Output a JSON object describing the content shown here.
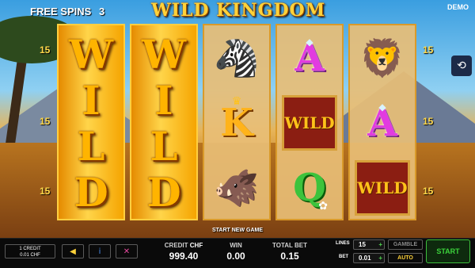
{
  "header": {
    "free_spins_label": "FREE SPINS",
    "free_spins_count": "3",
    "logo": "WILD KINGDOM",
    "mode": "DEMO"
  },
  "paylines": {
    "left": [
      "15",
      "15",
      "15"
    ],
    "right": [
      "15",
      "15",
      "15"
    ]
  },
  "reels": [
    {
      "type": "wild-stack",
      "letters": [
        "W",
        "I",
        "L",
        "D"
      ]
    },
    {
      "type": "wild-stack",
      "letters": [
        "W",
        "I",
        "L",
        "D"
      ]
    },
    {
      "type": "symbols",
      "symbols": [
        {
          "kind": "animal",
          "name": "zebra-icon",
          "glyph": "🦓"
        },
        {
          "kind": "letter",
          "name": "king-symbol",
          "text": "K"
        },
        {
          "kind": "animal",
          "name": "warthog-icon",
          "glyph": "🐗"
        }
      ]
    },
    {
      "type": "symbols",
      "symbols": [
        {
          "kind": "letter",
          "name": "ace-symbol",
          "text": "A"
        },
        {
          "kind": "wild",
          "name": "wild-symbol",
          "text": "WILD"
        },
        {
          "kind": "letter",
          "name": "queen-symbol",
          "text": "Q"
        }
      ]
    },
    {
      "type": "symbols",
      "symbols": [
        {
          "kind": "animal",
          "name": "lion-icon",
          "glyph": "🦁"
        },
        {
          "kind": "letter",
          "name": "ace-symbol",
          "text": "A"
        },
        {
          "kind": "wild",
          "name": "wild-symbol",
          "text": "WILD"
        }
      ]
    }
  ],
  "prompt": "START NEW GAME",
  "footer": {
    "credit_box": {
      "line1": "1 CREDIT",
      "line2": "0.01 CHF"
    },
    "sound_icon": "◀",
    "info_icon": "i",
    "fullscreen_icon": "✕",
    "credit": {
      "label": "CREDIT",
      "currency": "CHF",
      "value": "999.40"
    },
    "win": {
      "label": "WIN",
      "value": "0.00"
    },
    "total_bet": {
      "label": "TOTAL BET",
      "value": "0.15"
    },
    "lines": {
      "label": "LINES",
      "value": "15",
      "plus": "+"
    },
    "bet": {
      "label": "BET",
      "value": "0.01",
      "plus": "+"
    },
    "gamble": "GAMBLE",
    "auto": "AUTO",
    "start": "START"
  },
  "history_icon": "⟲",
  "colors": {
    "accent": "#ffd23a",
    "start_green": "#3cd43c",
    "auto_yellow": "#ffd23a"
  }
}
